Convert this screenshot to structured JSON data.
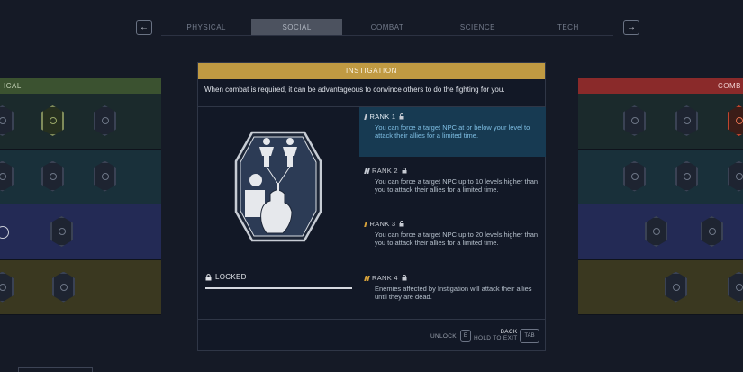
{
  "tabs": [
    {
      "label": "PHYSICAL",
      "active": false
    },
    {
      "label": "SOCIAL",
      "active": true
    },
    {
      "label": "COMBAT",
      "active": false
    },
    {
      "label": "SCIENCE",
      "active": false
    },
    {
      "label": "TECH",
      "active": false
    }
  ],
  "nav": {
    "prev_icon": "←",
    "next_icon": "→"
  },
  "left_panel": {
    "header": "ICAL"
  },
  "right_panel": {
    "header": "COMB"
  },
  "modal": {
    "title": "INSTIGATION",
    "description": "When combat is required, it can be advantageous to convince others to do the fighting for you.",
    "emblem_icon": "instigation-emblem-icon",
    "status": "LOCKED"
  },
  "ranks": [
    {
      "label": "RANK 1",
      "text": "You can force a target NPC at or below your level to attack their allies for a limited time.",
      "active": true
    },
    {
      "label": "RANK 2",
      "text": "You can force a target NPC up to 10 levels higher than you to attack their allies for a limited time.",
      "active": false
    },
    {
      "label": "RANK 3",
      "text": "You can force a target NPC up to 20 levels higher than you to attack their allies for a limited time.",
      "active": false
    },
    {
      "label": "RANK 4",
      "text": "Enemies affected by Instigation will attack their allies until they are dead.",
      "active": false
    }
  ],
  "footer": {
    "unlock_label": "UNLOCK",
    "unlock_key": "E",
    "back_label": "BACK",
    "hold_label": "HOLD TO EXIT",
    "back_key": "TAB"
  },
  "colors": {
    "modal_header": "#c09a42",
    "left_header": "#3b5230",
    "right_header": "#8a2a2a",
    "active_rank": "#173a52",
    "rank_pip_gold": "#d6a13a"
  }
}
